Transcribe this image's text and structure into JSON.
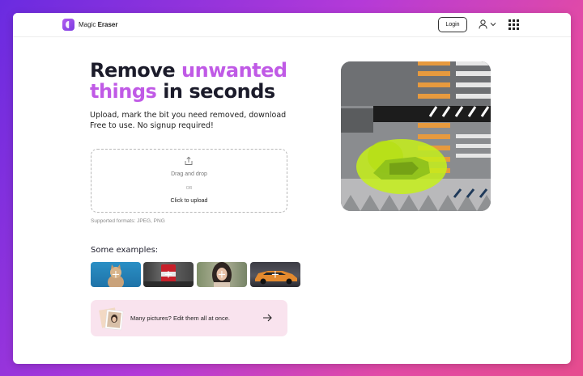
{
  "brand": {
    "name_light": "Magic",
    "name_bold": "Eraser",
    "accent": "#c05ae6"
  },
  "nav": {
    "login_label": "Login",
    "user_icon": "user-icon",
    "chevron_icon": "chevron-down-icon",
    "apps_icon": "apps-grid-icon"
  },
  "hero": {
    "title_part1": "Remove",
    "title_accent": "unwanted",
    "title_part2": "things",
    "title_part3": "in seconds",
    "subtitle_line1": "Upload, mark the bit you need removed, download",
    "subtitle_line2": "Free to use. No signup required!"
  },
  "upload": {
    "drag_label": "Drag and drop",
    "or_label": "OR",
    "click_label": "Click to upload",
    "formats": "Supported formats: JPEG, PNG",
    "icon": "upload-icon"
  },
  "examples": {
    "title": "Some examples:",
    "items": [
      {
        "name": "example-cat",
        "plus": "+"
      },
      {
        "name": "example-can",
        "plus": "+"
      },
      {
        "name": "example-woman",
        "plus": "+"
      },
      {
        "name": "example-car",
        "plus": "+"
      }
    ]
  },
  "multi": {
    "text": "Many pictures? Edit them all at once.",
    "icon": "arrow-right-icon"
  }
}
